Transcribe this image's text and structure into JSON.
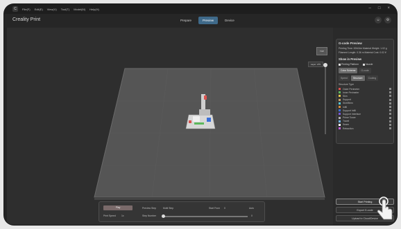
{
  "window": {
    "menu": [
      "File(F)",
      "Edit(E)",
      "View(V)",
      "Tool(T)",
      "Model(M)",
      "Help(H)"
    ],
    "controls": [
      "–",
      "□",
      "×"
    ]
  },
  "header": {
    "brand": "Creality Print",
    "tabs": [
      "Prepare",
      "Preview",
      "Device"
    ],
    "active_tab": "Preview"
  },
  "viewport": {
    "view_cube_label": "TOP",
    "layer_badge": "Layer: 275"
  },
  "gcode_panel": {
    "title": "G-code Preview",
    "stats": [
      "Printing Time: 00h04m   Material Weight: 1.02 g",
      "Filament Length: 0.36 m   Material Cost: 0.02 ¥"
    ],
    "show_in_preview_title": "Show in Preview",
    "show_options": [
      "Printing Platform",
      "Nozzle"
    ],
    "color_scheme_tabs": [
      "Color Scheme",
      "G-code"
    ],
    "scheme_tabs": [
      "Speed",
      "Structure",
      "Cooling"
    ],
    "active_scheme_tab": "Structure",
    "list_header": "Structure Type",
    "features": [
      {
        "name": "Outer Perimeter",
        "color": "#d9534f"
      },
      {
        "name": "Inner Perimeter",
        "color": "#5cb85c"
      },
      {
        "name": "Skin",
        "color": "#e6c84a"
      },
      {
        "name": "Support",
        "color": "#c7a36a"
      },
      {
        "name": "Skirt/Brim",
        "color": "#55c7d9"
      },
      {
        "name": "Infill",
        "color": "#d98c3a"
      },
      {
        "name": "Support Infill",
        "color": "#3a6fd9"
      },
      {
        "name": "Support Interface",
        "color": "#7a5ad9"
      },
      {
        "name": "Prime Tower",
        "color": "#b0b0b0"
      },
      {
        "name": "Travel",
        "color": "#6fb3e6"
      },
      {
        "name": "Seam",
        "color": "#ffffff"
      },
      {
        "name": "Retraction",
        "color": "#c05ad9"
      }
    ]
  },
  "bottom_panel": {
    "play_label": "Play",
    "preview_step_label": "Preview Step",
    "preview_step_value": "Multi Step",
    "start_from_label": "Start From",
    "start_from_value": "0",
    "auto_label": "Auto",
    "print_speed_label": "Print Speed",
    "print_speed_value": "1x",
    "step_number_label": "Step Number",
    "step_number_value": "0"
  },
  "actions": {
    "start_printing": "Start Printing",
    "export_gcode": "Export G-code",
    "upload_to_device": "Upload to Cloud/Device"
  }
}
